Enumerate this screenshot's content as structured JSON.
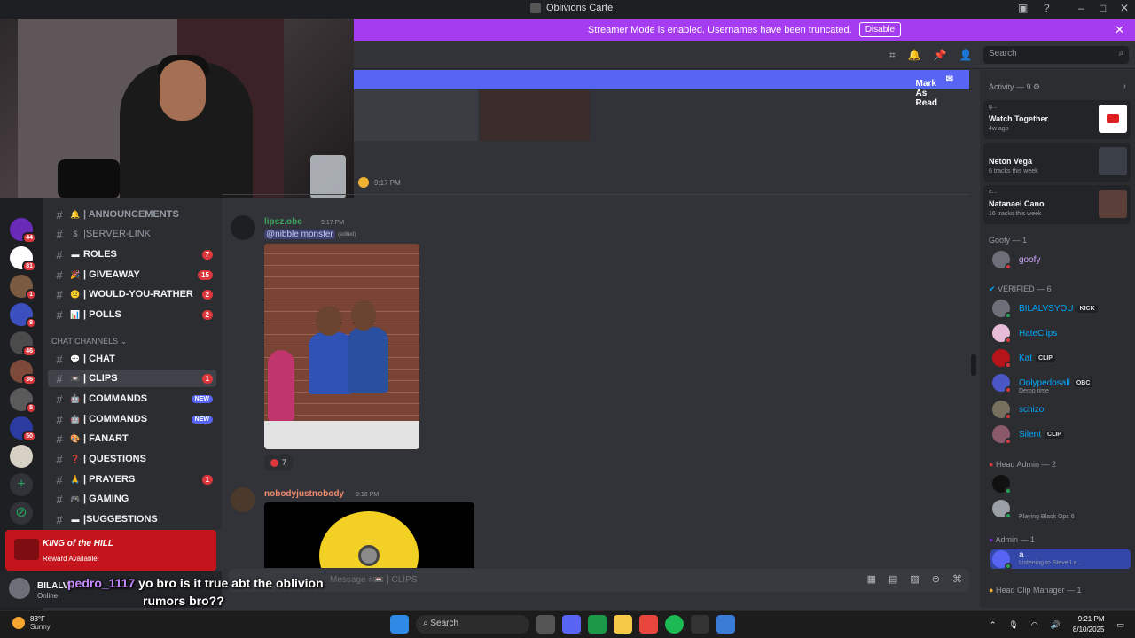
{
  "window": {
    "title": "Oblivions Cartel"
  },
  "banner": {
    "text": "Streamer Mode is enabled. Usernames have been truncated.",
    "button": "Disable"
  },
  "header": {
    "search_placeholder": "Search"
  },
  "unread_bar": {
    "label": "Mark As Read"
  },
  "channels": {
    "category": "CHAT CHANNELS",
    "items": [
      {
        "label": "| ANNOUNCEMENTS",
        "emoji": "🔔"
      },
      {
        "label": "|SERVER-LINK",
        "emoji": "$"
      },
      {
        "label": "ROLES",
        "emoji": "▬",
        "count": "7"
      },
      {
        "label": "| GIVEAWAY",
        "emoji": "🎉",
        "count": "15"
      },
      {
        "label": "| WOULD-YOU-RATHER",
        "emoji": "😐",
        "count": "2"
      },
      {
        "label": "| POLLS",
        "emoji": "📊",
        "count": "2"
      },
      {
        "label": "| CHAT",
        "emoji": "💬"
      },
      {
        "label": "| CLIPS",
        "emoji": "📼",
        "count": "1"
      },
      {
        "label": "| COMMANDS",
        "emoji": "🤖",
        "new": "NEW"
      },
      {
        "label": "| COMMANDS",
        "emoji": "🤖",
        "new": "NEW"
      },
      {
        "label": "| FANART",
        "emoji": "🎨"
      },
      {
        "label": "| QUESTIONS",
        "emoji": "❓"
      },
      {
        "label": "| PRAYERS",
        "emoji": "🙏",
        "count": "1"
      },
      {
        "label": "| GAMING",
        "emoji": "🎮"
      },
      {
        "label": "|SUGGESTIONS",
        "emoji": "▬"
      }
    ]
  },
  "servers": {
    "badges": [
      "44",
      "81",
      "1",
      "8",
      "46",
      "36",
      "5",
      "50"
    ]
  },
  "promo": {
    "title": "KING of the HILL",
    "subtitle": "Reward Available!"
  },
  "user": {
    "name": "BILALVS",
    "status": "Online"
  },
  "messages": {
    "prev_time": "9:17 PM",
    "m1": {
      "author": "lipsz.obc",
      "time": "9:17 PM",
      "mention": "@nibble monster",
      "edited": "(edited)",
      "reaction_count": "7"
    },
    "m2": {
      "author": "nobodyjustnobody",
      "time": "9:18 PM"
    }
  },
  "composer": {
    "placeholder": "Message #📼 | CLIPS"
  },
  "caption": {
    "user": "pedro_1117",
    "line1": " yo bro is it true abt the oblivion",
    "line2": "rumors bro??"
  },
  "members": {
    "activity_header": "Activity — 9",
    "activities": [
      {
        "small": "g...",
        "title": "Watch Together",
        "sub": "4w ago"
      },
      {
        "small": "",
        "title": "Neton Vega",
        "sub": "6 tracks this week"
      },
      {
        "small": "c...",
        "title": "Natanael Cano",
        "sub": "16 tracks this week"
      }
    ],
    "groups": {
      "goofy": "Goofy — 1",
      "verified": "VERIFIED — 6",
      "head_admin": "Head Admin — 2",
      "admin": "Admin — 1",
      "head_clip": "Head Clip Manager — 1"
    },
    "list": [
      {
        "name": "goofy",
        "color": "#d4a8ff"
      },
      {
        "name": "BILALVSYOU",
        "color": "#00a8fc",
        "tag": "KICK"
      },
      {
        "name": "HateClips",
        "color": "#00a8fc"
      },
      {
        "name": "Kat",
        "color": "#00a8fc",
        "tag": "CLIP"
      },
      {
        "name": "Onlypedosall",
        "color": "#00a8fc",
        "tag": "OBC",
        "sub": "Demo time"
      },
      {
        "name": "schizo",
        "color": "#00a8fc"
      },
      {
        "name": "Silent",
        "color": "#00a8fc",
        "tag": "CLIP"
      },
      {
        "name": "",
        "color": "#5c5c5c"
      },
      {
        "name": "",
        "color": "#5c5c5c",
        "sub": "Playing Black Ops 6"
      },
      {
        "name": "a",
        "color": "#ffffff",
        "sub": "Listening to Steve La..."
      }
    ]
  },
  "taskbar": {
    "temp": "83°F",
    "weather": "Sunny",
    "search": "Search",
    "time": "9:21 PM",
    "date": "8/10/2025"
  }
}
